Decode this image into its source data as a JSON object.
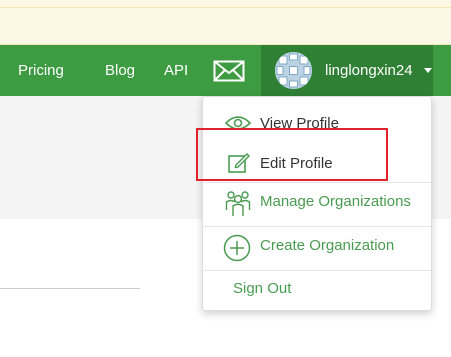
{
  "nav": {
    "links": [
      "Pricing",
      "Blog",
      "API"
    ],
    "mail_icon": "envelope-icon",
    "username": "linglongxin24",
    "caret_icon": "caret-down-icon",
    "bar_color": "#3d9b42",
    "active_color": "#2f7f35"
  },
  "dropdown": {
    "view_profile": "View Profile",
    "edit_profile": "Edit Profile",
    "manage_orgs": "Manage Organizations",
    "create_org": "Create Organization",
    "sign_out": "Sign Out",
    "accent_color": "#4a9b51",
    "icons": [
      "eye-icon",
      "edit-icon",
      "people-icon",
      "plus-circle-icon"
    ]
  },
  "highlight": {
    "target": "Edit Profile",
    "color": "#e0232b"
  }
}
